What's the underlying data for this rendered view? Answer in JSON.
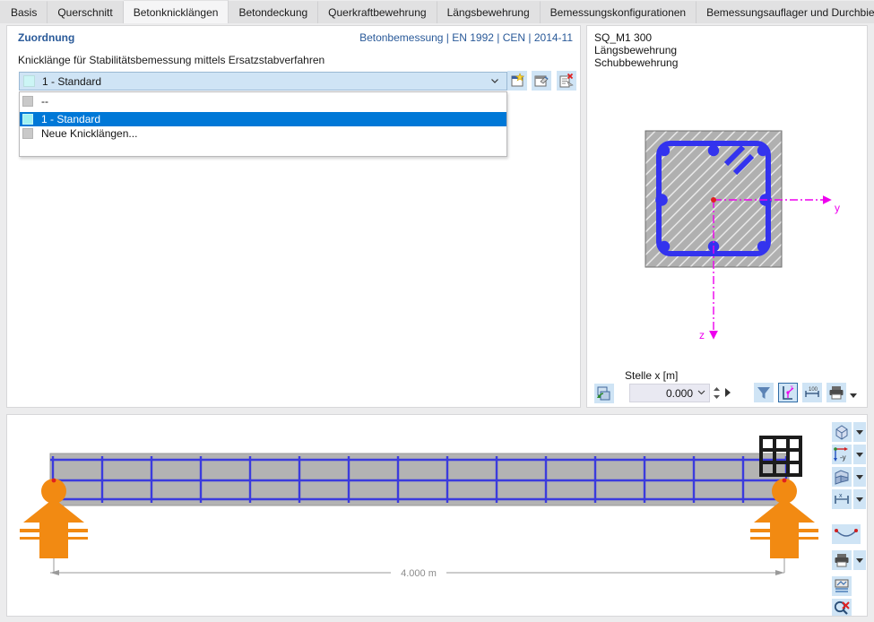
{
  "tabs": [
    {
      "label": "Basis",
      "active": false
    },
    {
      "label": "Querschnitt",
      "active": false
    },
    {
      "label": "Betonknicklängen",
      "active": true
    },
    {
      "label": "Betondeckung",
      "active": false
    },
    {
      "label": "Querkraftbewehrung",
      "active": false
    },
    {
      "label": "Längsbewehrung",
      "active": false
    },
    {
      "label": "Bemessungskonfigurationen",
      "active": false
    },
    {
      "label": "Bemessungsauflager und Durchbiegung",
      "active": false
    }
  ],
  "left_panel": {
    "section_title": "Zuordnung",
    "code_info": "Betonbemessung | EN 1992 | CEN | 2014-11",
    "field_label": "Knicklänge für Stabilitätsbemessung mittels Ersatzstabverfahren",
    "combo": {
      "value": "1 - Standard",
      "swatch_color": "#ccf5f5",
      "arrow_icon": "chevron-down-icon",
      "expanded": true
    },
    "dropdown_options": [
      {
        "label": "--",
        "swatch_color": "#c9c9c9",
        "selected": false
      },
      {
        "label": "1 - Standard",
        "swatch_color": "#9ff0f0",
        "selected": true
      },
      {
        "label": "Neue Knicklängen...",
        "swatch_color": "#c9c9c9",
        "selected": false
      }
    ],
    "toolbar": [
      {
        "name": "new-buckling-length-button",
        "icon": "new-item-icon"
      },
      {
        "name": "edit-buckling-length-button",
        "icon": "edit-item-icon"
      },
      {
        "name": "delete-buckling-length-button",
        "icon": "delete-item-icon"
      }
    ]
  },
  "right_panel": {
    "title_lines": "SQ_M1 300\nLängsbewehrung\nSchubbewehrung",
    "cross_section": {
      "y_axis_label": "y",
      "z_axis_label": "z",
      "concrete_color": "#b0b0b0",
      "rebar_color": "#3333ee",
      "axis_color": "#ee00ee",
      "rebar_count": 8
    },
    "position_label": "Stelle x [m]",
    "position_value": "0.000",
    "spin_icons": {
      "dropdown": "chevron-down-icon",
      "stepper": "spinner-updown-icon",
      "next": "play-right-icon"
    },
    "left_tool": {
      "name": "sync-view-button",
      "icon": "refresh-view-icon"
    },
    "tools": [
      {
        "name": "filter-button",
        "icon": "filter-funnel-icon",
        "active": false
      },
      {
        "name": "axis-system-button",
        "icon": "axis-system-icon",
        "active": true
      },
      {
        "name": "dimensions-button",
        "icon": "dimension-line-icon",
        "active": false
      },
      {
        "name": "print-button",
        "icon": "printer-icon",
        "active": false
      }
    ],
    "print_dropdown_icon": "caret-down-icon"
  },
  "graphics_panel": {
    "dimension_label": "4.000 m",
    "beam": {
      "length_m": 4.0,
      "concrete_color": "#b3b3b3",
      "rebar_color": "#3b3bdd",
      "support_color": "#f28a12",
      "stirrup_count": 15
    },
    "axis_indicator_label": "-y",
    "toolbar": [
      {
        "name": "view-3d-button",
        "icon": "cube-icon",
        "has_caret": true
      },
      {
        "name": "view-direction-button",
        "icon": "axis-minus-y-icon",
        "has_caret": true
      },
      {
        "name": "render-mode-button",
        "icon": "render-solid-icon",
        "has_caret": true
      },
      {
        "name": "dimension-mode-button",
        "icon": "dimension-x-icon",
        "has_caret": true
      },
      {
        "name": "deformation-button",
        "icon": "deformed-shape-icon",
        "has_caret": false
      },
      {
        "name": "print-graphic-button",
        "icon": "printer-icon",
        "has_caret": true
      },
      {
        "name": "print-report-button",
        "icon": "printout-report-icon",
        "has_caret": false
      },
      {
        "name": "reset-zoom-button",
        "icon": "magnifier-delete-icon",
        "has_caret": false
      }
    ]
  }
}
